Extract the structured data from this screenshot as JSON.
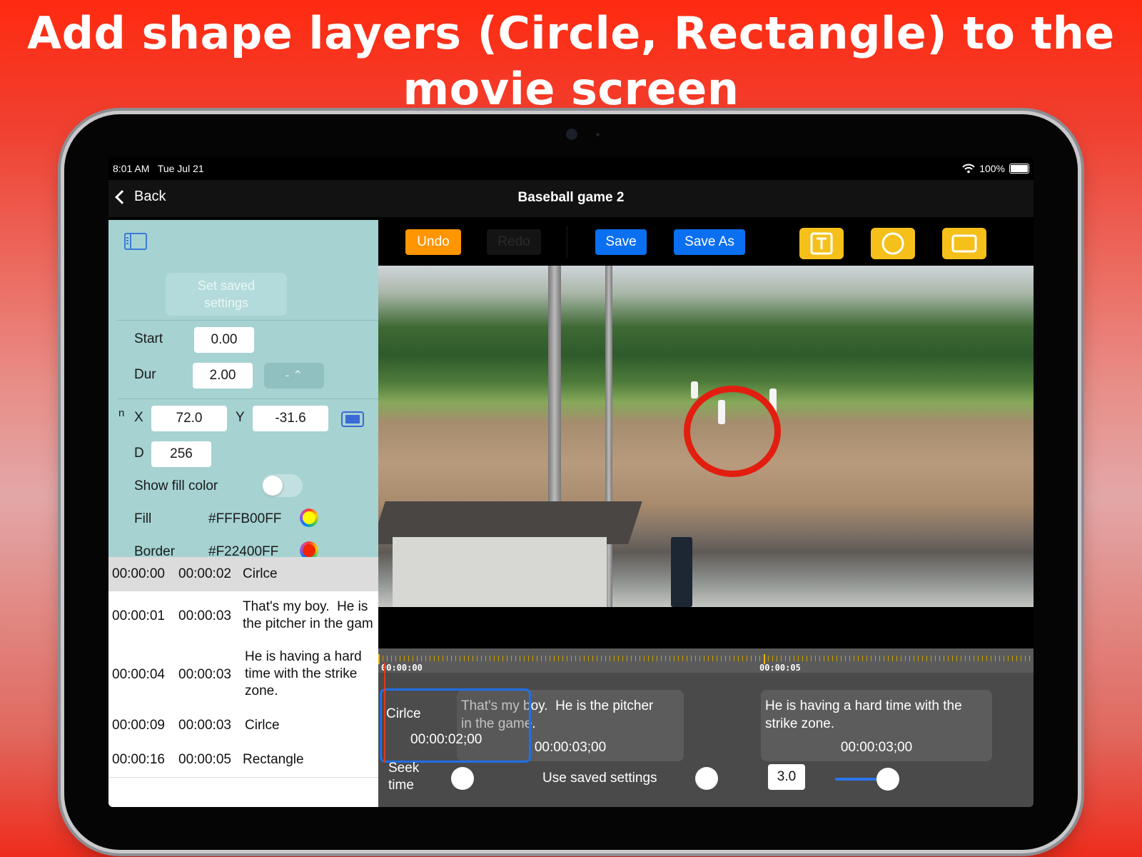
{
  "headline": {
    "line1": "Add shape layers (Circle, Rectangle) to the",
    "line2": "movie screen"
  },
  "status_bar": {
    "time": "8:01 AM",
    "date": "Tue Jul 21",
    "battery": "100%"
  },
  "nav": {
    "back_label": "Back",
    "title": "Baseball game 2"
  },
  "settings_panel": {
    "set_saved_label": "Set saved\nsettings",
    "start_label": "Start",
    "start_value": "0.00",
    "dur_label": "Dur",
    "dur_value": "2.00",
    "stepper_value": "- ⌃",
    "n_label": "n",
    "x_label": "X",
    "x_value": "72.0",
    "y_label": "Y",
    "y_value": "-31.6",
    "d_label": "D",
    "d_value": "256",
    "show_fill_label": "Show fill color",
    "show_fill_on": false,
    "fill_label": "Fill",
    "fill_value": "#FFFB00FF",
    "fill_color": "#fffb00",
    "border_label": "Border",
    "border_value": "#F22400FF",
    "border_color": "#f22400"
  },
  "layer_list": [
    {
      "start": "00:00:00",
      "duration": "00:00:02",
      "text": "Cirlce",
      "selected": true
    },
    {
      "start": "00:00:01",
      "duration": "00:00:03",
      "text": "That's my boy.  He is\nthe pitcher in the gam",
      "selected": false
    },
    {
      "start": "00:00:04",
      "duration": "00:00:03",
      "text": "He is having a hard\ntime with the strike\nzone.",
      "selected": false
    },
    {
      "start": "00:00:09",
      "duration": "00:00:03",
      "text": "Cirlce",
      "selected": false
    },
    {
      "start": "00:00:16",
      "duration": "00:00:05",
      "text": "Rectangle",
      "selected": false
    }
  ],
  "toolbar": {
    "undo_label": "Undo",
    "redo_label": "Redo",
    "save_label": "Save",
    "save_as_label": "Save As",
    "text_tool_icon": "text-box-icon",
    "circle_tool_icon": "circle-icon",
    "rect_tool_icon": "rectangle-icon",
    "undo_color": "#ff9500",
    "save_color": "#0a6ff0",
    "tool_color": "#f5c01a"
  },
  "timeline": {
    "tc_start": "00:00:00",
    "tc_mid": "00:00:05",
    "clips": [
      {
        "text": "Cirlce",
        "duration": "00:00:02;00"
      },
      {
        "text": "That's my boy.  He is the pitcher\nin the game.",
        "duration": "00:00:03;00"
      },
      {
        "text": "He is having a hard time with the\nstrike zone.",
        "duration": "00:00:03;00"
      }
    ],
    "seek_label": "Seek\ntime",
    "use_saved_label": "Use saved settings",
    "speed_value": "3.0",
    "speed_level": 0.75
  }
}
